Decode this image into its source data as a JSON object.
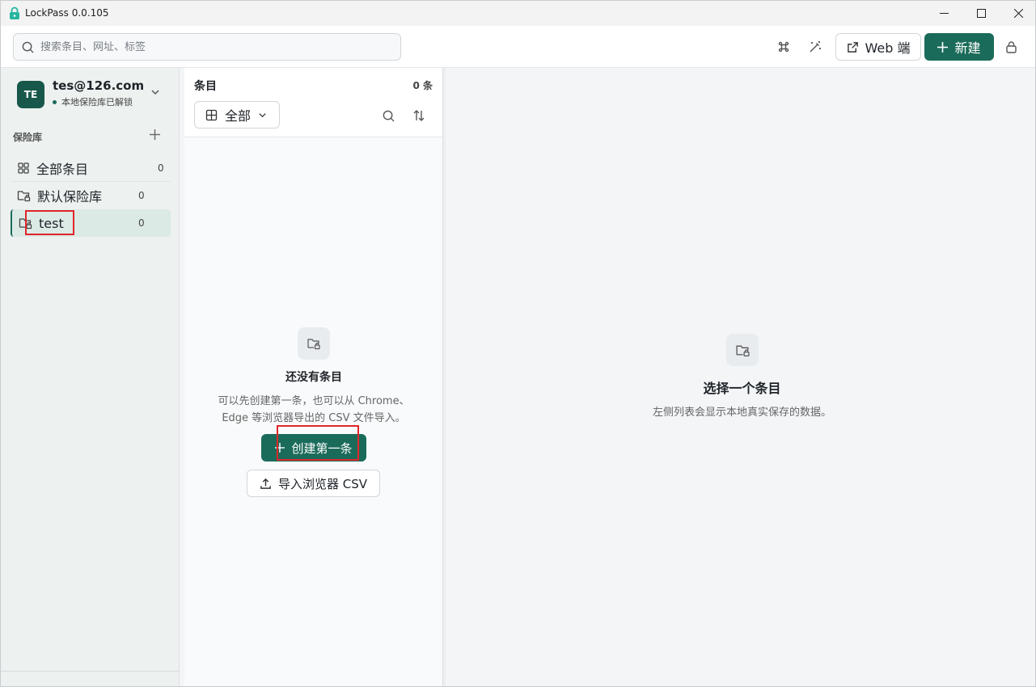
{
  "window": {
    "title": "LockPass 0.0.105"
  },
  "toolbar": {
    "search_placeholder": "搜索条目、网址、标签",
    "web_label": "Web 端",
    "new_label": "新建"
  },
  "account": {
    "avatar": "TE",
    "email": "tes@126.com",
    "status": "本地保险库已解锁"
  },
  "sidebar": {
    "section_title": "保险库",
    "items": [
      {
        "label": "全部条目",
        "count": "0"
      },
      {
        "label": "默认保险库",
        "count": "0"
      },
      {
        "label": "test",
        "count": "0"
      }
    ]
  },
  "list": {
    "title": "条目",
    "count": "0 条",
    "filter_label": "全部",
    "empty_title": "还没有条目",
    "empty_desc_line1": "可以先创建第一条，也可以从 Chrome、",
    "empty_desc_line2": "Edge 等浏览器导出的 CSV 文件导入。",
    "create_label": "创建第一条",
    "import_label": "导入浏览器 CSV"
  },
  "detail": {
    "empty_title": "选择一个条目",
    "empty_desc": "左侧列表会显示本地真实保存的数据。"
  },
  "colors": {
    "accent": "#1b6b5a",
    "annotation": "#e0262b"
  }
}
